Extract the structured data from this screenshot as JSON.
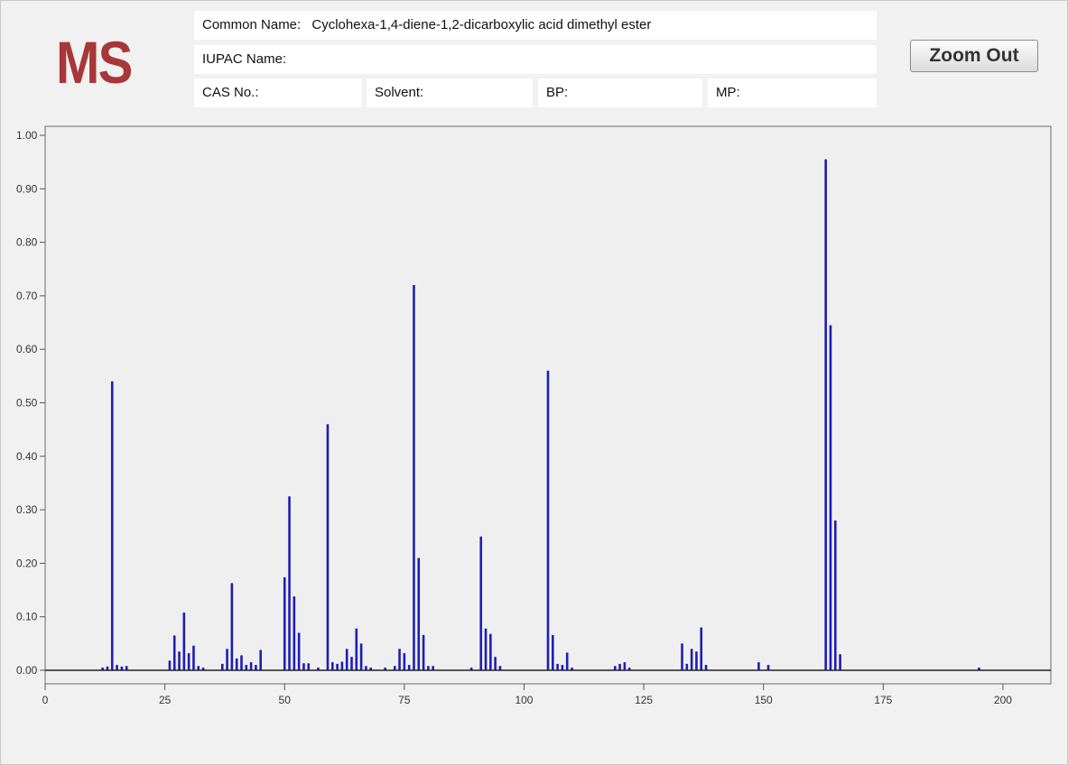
{
  "header": {
    "logo": "MS",
    "common_name_label": "Common Name:",
    "common_name_value": "Cyclohexa-1,4-diene-1,2-dicarboxylic acid dimethyl ester",
    "iupac_label": "IUPAC Name:",
    "iupac_value": "",
    "cas_label": "CAS No.:",
    "solvent_label": "Solvent:",
    "bp_label": "BP:",
    "mp_label": "MP:",
    "zoom_out_label": "Zoom Out"
  },
  "colors": {
    "bar": "#1e1eb4",
    "logo": "#a8373a",
    "axis": "#555555"
  },
  "chart_data": {
    "type": "bar",
    "title": "",
    "xlabel": "",
    "ylabel": "",
    "xlim": [
      0,
      210
    ],
    "ylim": [
      0,
      1.0
    ],
    "grid": false,
    "x_ticks": [
      0,
      25,
      50,
      75,
      100,
      125,
      150,
      175,
      200
    ],
    "y_ticks": [
      "0.00",
      "0.10",
      "0.20",
      "0.30",
      "0.40",
      "0.50",
      "0.60",
      "0.70",
      "0.80",
      "0.90",
      "1.00"
    ],
    "series": [
      {
        "mz": [
          12,
          13,
          14,
          15,
          16,
          17,
          26,
          27,
          28,
          29,
          30,
          31,
          32,
          33,
          37,
          38,
          39,
          40,
          41,
          42,
          43,
          44,
          45,
          50,
          51,
          52,
          53,
          54,
          55,
          57,
          59,
          60,
          61,
          62,
          63,
          64,
          65,
          66,
          67,
          68,
          71,
          73,
          74,
          75,
          76,
          77,
          78,
          79,
          80,
          81,
          89,
          91,
          92,
          93,
          94,
          95,
          105,
          106,
          107,
          108,
          109,
          110,
          119,
          120,
          121,
          122,
          133,
          134,
          135,
          136,
          137,
          138,
          149,
          151,
          163,
          164,
          165,
          166,
          195
        ],
        "intensity": [
          0.005,
          0.007,
          0.54,
          0.01,
          0.007,
          0.008,
          0.018,
          0.065,
          0.035,
          0.108,
          0.032,
          0.046,
          0.008,
          0.005,
          0.012,
          0.04,
          0.163,
          0.022,
          0.028,
          0.01,
          0.015,
          0.01,
          0.038,
          0.174,
          0.325,
          0.138,
          0.07,
          0.013,
          0.013,
          0.005,
          0.46,
          0.015,
          0.012,
          0.016,
          0.04,
          0.025,
          0.078,
          0.05,
          0.008,
          0.005,
          0.005,
          0.008,
          0.04,
          0.032,
          0.01,
          0.72,
          0.21,
          0.066,
          0.008,
          0.008,
          0.005,
          0.25,
          0.078,
          0.068,
          0.025,
          0.008,
          0.56,
          0.066,
          0.012,
          0.01,
          0.033,
          0.005,
          0.008,
          0.012,
          0.015,
          0.005,
          0.05,
          0.012,
          0.04,
          0.035,
          0.08,
          0.01,
          0.015,
          0.01,
          0.955,
          0.645,
          0.28,
          0.03,
          0.005
        ]
      }
    ]
  }
}
